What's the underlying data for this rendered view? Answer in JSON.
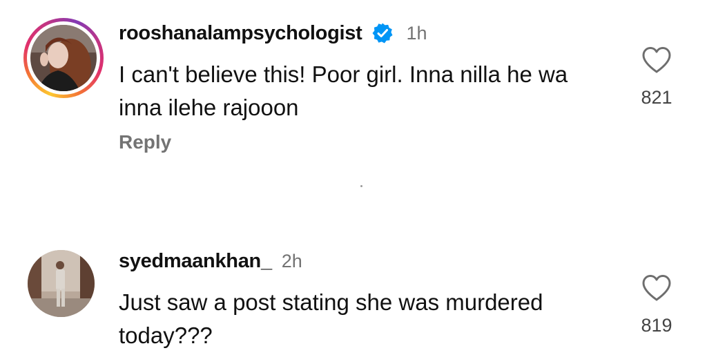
{
  "comments": [
    {
      "username": "rooshanalampsychologist",
      "verified": true,
      "time": "1h",
      "text": "I can't believe this! Poor girl. Inna nilla he wa inna ilehe rajooon",
      "likes": "821",
      "reply_label": "Reply",
      "has_story_ring": true
    },
    {
      "username": "syedmaankhan_",
      "verified": false,
      "time": "2h",
      "text": "Just saw a post stating she was murdered today???",
      "likes": "819",
      "has_story_ring": false
    }
  ],
  "icons": {
    "like": "heart-outline-icon",
    "verified": "verified-badge-icon"
  },
  "colors": {
    "verified_blue": "#0095f6",
    "secondary_text": "#737373",
    "primary_text": "#111111"
  }
}
